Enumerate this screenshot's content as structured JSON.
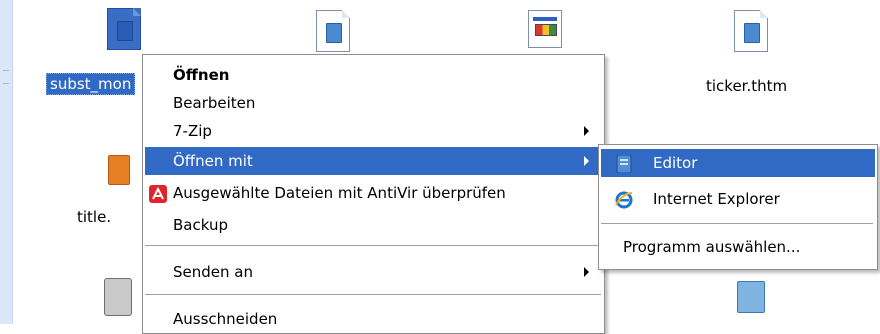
{
  "desktop": {
    "icons": [
      {
        "label": "subst_mon",
        "type": "doc",
        "selected": true
      },
      {
        "label": "",
        "type": "doc",
        "selected": false
      },
      {
        "label": "",
        "type": "app",
        "selected": false
      },
      {
        "label": "ticker.thtm",
        "type": "doc",
        "selected": false
      },
      {
        "label": "title.",
        "type": "image",
        "selected": false
      },
      {
        "label": "",
        "type": "recycle",
        "selected": false
      },
      {
        "label": "",
        "type": "gear",
        "selected": false
      }
    ]
  },
  "context_menu": {
    "items": [
      {
        "label": "Öffnen",
        "bold": true
      },
      {
        "label": "Bearbeiten"
      },
      {
        "label": "7-Zip",
        "submenu": true
      },
      {
        "label": "Öffnen mit",
        "submenu": true,
        "highlighted": true
      },
      {
        "label": "Ausgewählte Dateien mit AntiVir überprüfen",
        "icon": "antivir-icon"
      },
      {
        "label": "Backup"
      },
      {
        "label": "Senden an",
        "submenu": true
      },
      {
        "label": "Ausschneiden"
      }
    ]
  },
  "submenu": {
    "items": [
      {
        "label": "Editor",
        "icon": "notepad-icon",
        "highlighted": true
      },
      {
        "label": "Internet Explorer",
        "icon": "internet-explorer-icon"
      },
      {
        "label": "Programm auswählen..."
      }
    ]
  },
  "colors": {
    "highlight": "#316ac5",
    "desktop": "#ffffff",
    "menu_border": "#8e8e8e"
  }
}
